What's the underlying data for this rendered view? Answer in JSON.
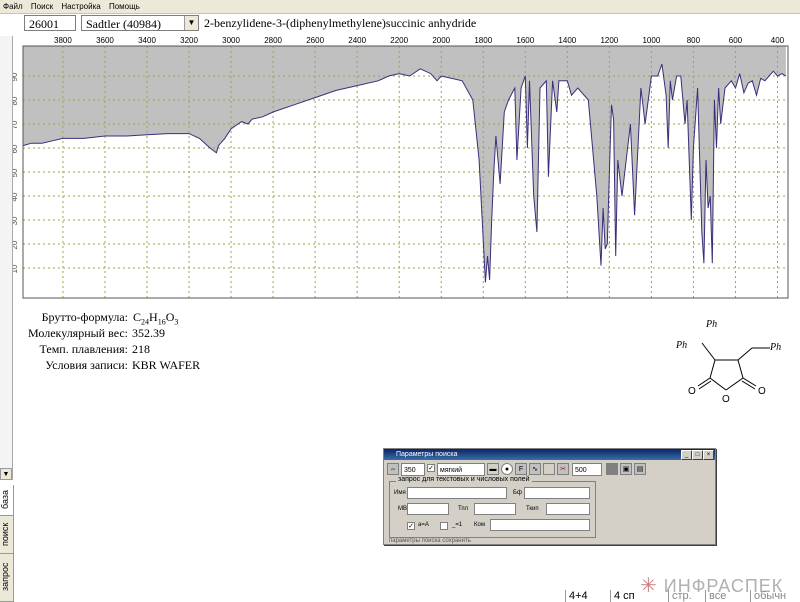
{
  "menu": [
    "Файл",
    "Поиск",
    "Настройка",
    "Помощь"
  ],
  "record": {
    "id": "26001",
    "library": "Sadtler (40984)",
    "compound_name": "2-benzylidene-3-(diphenylmethylene)succinic anhydride"
  },
  "properties": [
    {
      "label": "Брутто-формула:",
      "value": "C24H16O3"
    },
    {
      "label": "Молекулярный вес:",
      "value": "352.39"
    },
    {
      "label": "Темп. плавления:",
      "value": "218"
    },
    {
      "label": "Условия записи:",
      "value": "KBR WAFER"
    }
  ],
  "structure_labels": {
    "ph1": "Ph",
    "ph2": "Ph",
    "ph3": "Ph"
  },
  "vertical_tabs": [
    "база",
    "поиск",
    "запрос"
  ],
  "dialog": {
    "title": "Параметры поиска",
    "count_value": "350",
    "mode_value": "мягкий",
    "limit_value": "500",
    "group_label": "запрос для текстовых и числовых полей",
    "labels": {
      "name": "Имя",
      "bf": "Бф",
      "mw": "МВ",
      "tpl": "Тпл",
      "tkip": "Ткип",
      "aeqA": "a=A",
      "eq1": "_=1",
      "kom": "Ком"
    },
    "bottom_text": "параметры поиска      сохранить"
  },
  "statusbar": {
    "s1": "4+4",
    "s2": "4 сп",
    "s3": "стр.",
    "s4": "все",
    "s5": "обычн"
  },
  "logo_text": "ИНФРАСПЕК",
  "chart_data": {
    "type": "line",
    "title": "",
    "x_ticks": [
      3800,
      3600,
      3400,
      3200,
      3000,
      2800,
      2600,
      2400,
      2200,
      2000,
      1800,
      1600,
      1400,
      1200,
      1000,
      800,
      600,
      400
    ],
    "y_ticks": [
      10,
      20,
      30,
      40,
      50,
      60,
      70,
      80,
      90
    ],
    "xlim": [
      3990,
      350
    ],
    "ylim": [
      0,
      100
    ],
    "x_label": "",
    "y_label": "",
    "grid": true,
    "colors": {
      "line": "#3d2d7a",
      "fill": "#c0c0c0",
      "grid": "#9aa64a"
    },
    "series": [
      {
        "x": [
          3990,
          3950,
          3900,
          3850,
          3800,
          3700,
          3600,
          3500,
          3400,
          3300,
          3200,
          3150,
          3100,
          3070,
          3060,
          3030,
          3000,
          2950,
          2920,
          2900,
          2850,
          2800,
          2700,
          2600,
          2500,
          2400,
          2300,
          2250,
          2200,
          2150,
          2100,
          2050,
          2020,
          2000,
          1950,
          1900,
          1850,
          1820,
          1805,
          1790,
          1780,
          1770,
          1760,
          1750,
          1740,
          1720,
          1700,
          1680,
          1650,
          1640,
          1620,
          1600,
          1590,
          1580,
          1560,
          1545,
          1530,
          1500,
          1490,
          1470,
          1450,
          1440,
          1400,
          1380,
          1350,
          1300,
          1260,
          1240,
          1230,
          1220,
          1210,
          1200,
          1190,
          1180,
          1170,
          1160,
          1140,
          1100,
          1080,
          1050,
          1030,
          1000,
          970,
          950,
          930,
          920,
          910,
          900,
          880,
          860,
          840,
          830,
          810,
          800,
          780,
          760,
          750,
          740,
          730,
          720,
          710,
          700,
          690,
          680,
          670,
          650,
          620,
          600,
          580,
          560,
          540,
          520,
          500,
          480,
          460,
          440,
          420,
          400,
          380,
          360
        ],
        "y": [
          61,
          62,
          62,
          63,
          64,
          64,
          65,
          65,
          65.5,
          66,
          66,
          64,
          60,
          58,
          61,
          64,
          68,
          71,
          70,
          72,
          73,
          75,
          78,
          81,
          84,
          86,
          88,
          90,
          91,
          90,
          93,
          91,
          88,
          90,
          89,
          88,
          80,
          55,
          30,
          4,
          15,
          5,
          30,
          50,
          65,
          45,
          75,
          80,
          85,
          55,
          85,
          90,
          60,
          88,
          40,
          25,
          85,
          88,
          48,
          88,
          75,
          88,
          88,
          82,
          85,
          80,
          40,
          11,
          35,
          18,
          20,
          50,
          78,
          72,
          15,
          55,
          40,
          70,
          32,
          85,
          70,
          90,
          90,
          95,
          82,
          60,
          88,
          80,
          90,
          90,
          70,
          80,
          30,
          60,
          85,
          25,
          12,
          55,
          35,
          40,
          12,
          80,
          60,
          85,
          70,
          85,
          88,
          85,
          91,
          83,
          87,
          88,
          82,
          89,
          88,
          90,
          92,
          90,
          91,
          90
        ]
      }
    ]
  }
}
